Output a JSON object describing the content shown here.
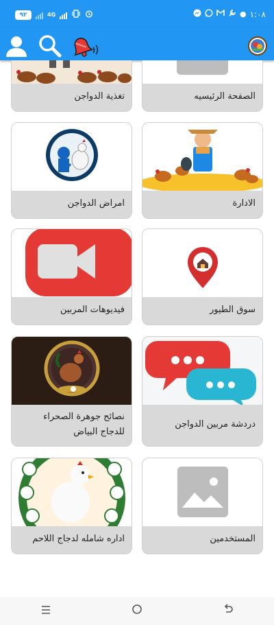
{
  "status_bar": {
    "time": "١:٠٨",
    "battery": "٩٢",
    "network": "4G"
  },
  "app_bar": {
    "icons": [
      "account-icon",
      "search-icon",
      "notification-bell-icon",
      "app-logo"
    ]
  },
  "cards": [
    {
      "label": "تغذية الدواجن"
    },
    {
      "label": "الصفحة الرئيسيه"
    },
    {
      "label": "امراض الدواجن"
    },
    {
      "label": "الادارة"
    },
    {
      "label": "فيديوهات المربين"
    },
    {
      "label": "سوق الطيور"
    },
    {
      "label": "نصائح جوهرة الصحراء للدجاج البياض"
    },
    {
      "label": "دردشة مربين الدواجن"
    },
    {
      "label": "اداره شامله لدجاج اللاحم"
    },
    {
      "label": "المستخدمين"
    }
  ],
  "nav_bar": {
    "recents_icon": "menu-icon",
    "home_icon": "home-circle-icon",
    "back_icon": "back-icon"
  },
  "colors": {
    "primary": "#2196f3",
    "card_bg": "#d9d9d9",
    "video_red": "#e53935",
    "chat_red": "#e53935",
    "chat_cyan": "#29b6d3"
  }
}
